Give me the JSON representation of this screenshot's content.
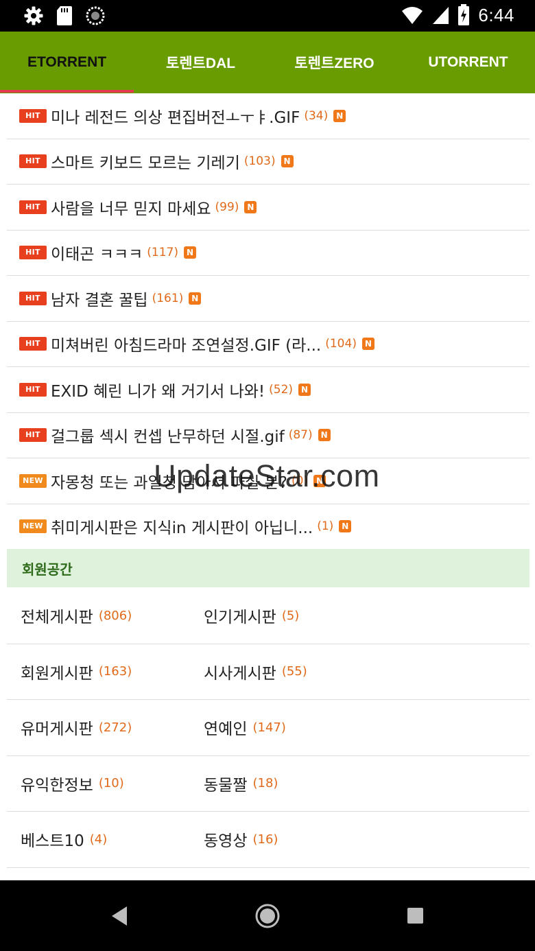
{
  "status_bar": {
    "time": "6:44",
    "icons": [
      "gear-icon",
      "sd-card-icon",
      "sync-icon",
      "wifi-icon",
      "signal-icon",
      "battery-charging-icon"
    ]
  },
  "tabs": [
    {
      "label": "ETORRENT",
      "active": true
    },
    {
      "label": "토렌트DAL",
      "active": false
    },
    {
      "label": "토렌트ZERO",
      "active": false
    },
    {
      "label": "UTORRENT",
      "active": false
    }
  ],
  "colors": {
    "tab_bar": "#699c00",
    "tab_indicator": "#e23a4f",
    "hit_badge": "#e8401f",
    "new_badge": "#f08a1c",
    "count": "#e06a1a",
    "section_bg": "#dff3dc"
  },
  "hot_list": [
    {
      "badge": "HIT",
      "title": "미나 레전드 의상 편집버전ㅗㅜㅑ.GIF",
      "count": "(34)",
      "new_icon": "N"
    },
    {
      "badge": "HIT",
      "title": "스마트 키보드 모르는 기레기",
      "count": "(103)",
      "new_icon": "N"
    },
    {
      "badge": "HIT",
      "title": "사람을 너무 믿지 마세요",
      "count": "(99)",
      "new_icon": "N"
    },
    {
      "badge": "HIT",
      "title": "이태곤 ㅋㅋㅋ",
      "count": "(117)",
      "new_icon": "N"
    },
    {
      "badge": "HIT",
      "title": "남자 결혼 꿀팁",
      "count": "(161)",
      "new_icon": "N"
    },
    {
      "badge": "HIT",
      "title": "미쳐버린 아침드라마 조연설정.GIF (라...",
      "count": "(104)",
      "new_icon": "N"
    },
    {
      "badge": "HIT",
      "title": "EXID 혜린 니가 왜 거기서 나와!",
      "count": "(52)",
      "new_icon": "N"
    },
    {
      "badge": "HIT",
      "title": "걸그룹 섹시 컨셉 난무하던 시절.gif",
      "count": "(87)",
      "new_icon": "N"
    },
    {
      "badge": "NEW",
      "title": "자몽청 또는 과일청 담아서 파실 분?",
      "count": "(0)",
      "new_icon": "N"
    },
    {
      "badge": "NEW",
      "title": "취미게시판은 지식in 게시판이 아닙니...",
      "count": "(1)",
      "new_icon": "N"
    }
  ],
  "watermark": "UpdateStar.com",
  "section": {
    "title": "회원공간"
  },
  "boards": [
    [
      {
        "name": "전체게시판",
        "count": "(806)"
      },
      {
        "name": "인기게시판",
        "count": "(5)"
      }
    ],
    [
      {
        "name": "회원게시판",
        "count": "(163)"
      },
      {
        "name": "시사게시판",
        "count": "(55)"
      }
    ],
    [
      {
        "name": "유머게시판",
        "count": "(272)"
      },
      {
        "name": "연예인",
        "count": "(147)"
      }
    ],
    [
      {
        "name": "유익한정보",
        "count": "(10)"
      },
      {
        "name": "동물짤",
        "count": "(18)"
      }
    ],
    [
      {
        "name": "베스트10",
        "count": "(4)"
      },
      {
        "name": "동영상",
        "count": "(16)"
      }
    ]
  ],
  "nav_bar": [
    "back-icon",
    "home-icon",
    "recents-icon"
  ]
}
